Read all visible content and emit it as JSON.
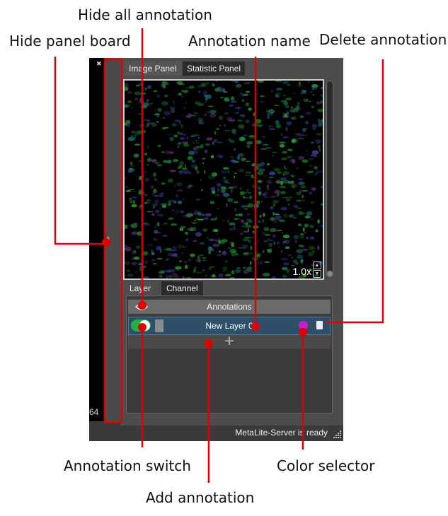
{
  "callouts": {
    "hide_all": "Hide all annotation",
    "hide_panel": "Hide panel board",
    "annotation_name": "Annotation name",
    "delete_annotation": "Delete annotation",
    "annotation_switch": "Annotation switch",
    "color_selector": "Color selector",
    "add_annotation": "Add annotation"
  },
  "app": {
    "left_panel": {
      "close_glyph": "✖",
      "partial_number": "64",
      "collapse_glyph": "›"
    },
    "tabs": [
      "Image Panel",
      "Statistic Panel"
    ],
    "image": {
      "zoom": "1.0x"
    },
    "subtabs": [
      "Layer",
      "Channel"
    ],
    "annotations": {
      "header": "Annotations",
      "layers": [
        {
          "name": "New Layer 0",
          "enabled": true,
          "color": "#c020d0"
        }
      ],
      "add_glyph": "+"
    },
    "status": "MetaLite-Server is ready"
  },
  "colors": {
    "callout_line": "#e00000",
    "toggle_on": "#21b34a",
    "layer_color": "#c020d0"
  },
  "icons": [
    "close-icon",
    "chevron-right-icon",
    "eye-icon",
    "toggle-switch-icon",
    "color-dot-icon",
    "trash-icon",
    "plus-icon",
    "resize-grip-icon"
  ]
}
